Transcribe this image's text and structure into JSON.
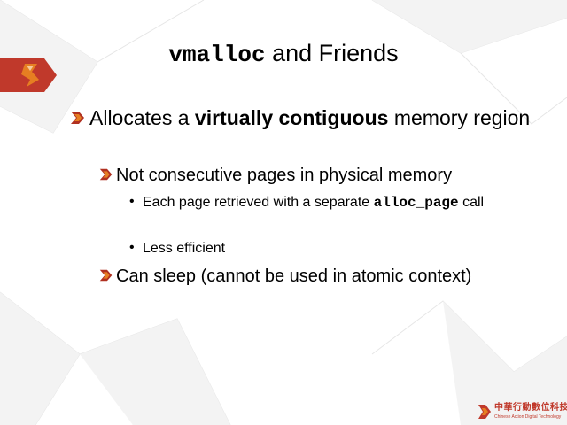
{
  "slide": {
    "title_code": "vmalloc",
    "title_rest": " and Friends",
    "b1_pre": "Allocates a ",
    "b1_bold": "virtually contiguous",
    "b1_post": " memory region",
    "b2": "Not consecutive pages in physical memory",
    "b3_pre": "Each page retrieved with a separate ",
    "b3_code": "alloc_page",
    "b3_post": " call",
    "b4": "Less efficient",
    "b5": "Can sleep (cannot be used in atomic context)",
    "bullet_char": "•"
  },
  "logo": {
    "name_zh": "中華行動數位科技",
    "name_en": "Chinese Action Digital Technology"
  },
  "colors": {
    "accent_red": "#c0392b",
    "accent_orange": "#e67e22",
    "text": "#000000"
  }
}
